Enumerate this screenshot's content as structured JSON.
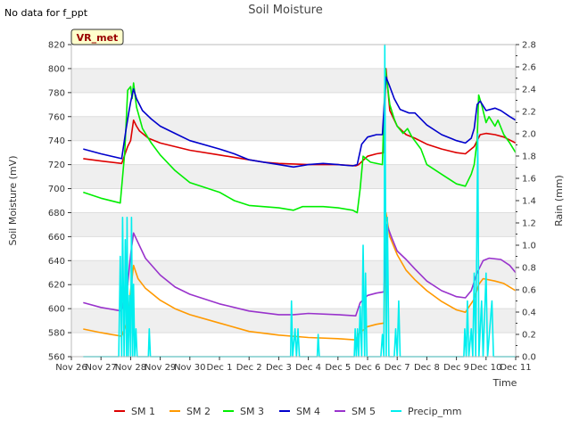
{
  "chart_data": {
    "type": "line",
    "title": "Soil Moisture",
    "top_note": "No data for f_ppt",
    "site_label": "VR_met",
    "xlabel": "Time",
    "ylabel": "Soil Moisture (mV)",
    "y2label": "Rain (mm)",
    "ylim": [
      560,
      820
    ],
    "y2lim": [
      0.0,
      2.8
    ],
    "xlim": [
      0,
      15
    ],
    "x_ticks": [
      "Nov 26",
      "Nov 27",
      "Nov 28",
      "Nov 29",
      "Nov 30",
      "Dec 1",
      "Dec 2",
      "Dec 3",
      "Dec 4",
      "Dec 5",
      "Dec 6",
      "Dec 7",
      "Dec 8",
      "Dec 9",
      "Dec 10",
      "Dec 11"
    ],
    "y_ticks": [
      560,
      580,
      600,
      620,
      640,
      660,
      680,
      700,
      720,
      740,
      760,
      780,
      800,
      820
    ],
    "y2_ticks": [
      "0.0",
      "0.2",
      "0.4",
      "0.6",
      "0.8",
      "1.0",
      "1.2",
      "1.4",
      "1.6",
      "1.8",
      "2.0",
      "2.2",
      "2.4",
      "2.6",
      "2.8"
    ],
    "grid": "horizontal bands",
    "legend_position": "bottom",
    "series": [
      {
        "name": "SM 1",
        "color": "#dd0000",
        "axis": "left",
        "points": [
          [
            0.4,
            725
          ],
          [
            1.0,
            723
          ],
          [
            1.7,
            721
          ],
          [
            1.9,
            735
          ],
          [
            2.0,
            740
          ],
          [
            2.1,
            757
          ],
          [
            2.2,
            752
          ],
          [
            2.3,
            748
          ],
          [
            2.6,
            742
          ],
          [
            3.0,
            738
          ],
          [
            4.0,
            732
          ],
          [
            5.0,
            728
          ],
          [
            6.0,
            724
          ],
          [
            6.5,
            722
          ],
          [
            7.0,
            721
          ],
          [
            8.0,
            720
          ],
          [
            9.0,
            720
          ],
          [
            9.6,
            719
          ],
          [
            9.7,
            720
          ],
          [
            10.0,
            727
          ],
          [
            10.3,
            729
          ],
          [
            10.55,
            730
          ],
          [
            10.62,
            800
          ],
          [
            10.75,
            765
          ],
          [
            11.0,
            752
          ],
          [
            11.3,
            745
          ],
          [
            11.6,
            742
          ],
          [
            12.0,
            737
          ],
          [
            12.5,
            733
          ],
          [
            13.0,
            730
          ],
          [
            13.3,
            729
          ],
          [
            13.6,
            735
          ],
          [
            13.8,
            745
          ],
          [
            14.0,
            746
          ],
          [
            14.3,
            745
          ],
          [
            14.6,
            743
          ],
          [
            15.0,
            738
          ]
        ]
      },
      {
        "name": "SM 2",
        "color": "#ff9900",
        "axis": "left",
        "points": [
          [
            0.4,
            583
          ],
          [
            1.0,
            580
          ],
          [
            1.7,
            577
          ],
          [
            1.9,
            590
          ],
          [
            2.0,
            615
          ],
          [
            2.1,
            636
          ],
          [
            2.25,
            625
          ],
          [
            2.5,
            617
          ],
          [
            3.0,
            607
          ],
          [
            3.5,
            600
          ],
          [
            4.0,
            595
          ],
          [
            5.0,
            588
          ],
          [
            6.0,
            581
          ],
          [
            7.0,
            578
          ],
          [
            8.0,
            576
          ],
          [
            9.0,
            575
          ],
          [
            9.6,
            574
          ],
          [
            9.7,
            579
          ],
          [
            10.0,
            585
          ],
          [
            10.3,
            587
          ],
          [
            10.55,
            588
          ],
          [
            10.62,
            680
          ],
          [
            10.75,
            660
          ],
          [
            11.0,
            645
          ],
          [
            11.3,
            632
          ],
          [
            11.6,
            624
          ],
          [
            12.0,
            615
          ],
          [
            12.5,
            606
          ],
          [
            13.0,
            599
          ],
          [
            13.3,
            597
          ],
          [
            13.6,
            608
          ],
          [
            13.75,
            620
          ],
          [
            13.9,
            625
          ],
          [
            14.3,
            623
          ],
          [
            14.6,
            621
          ],
          [
            15.0,
            615
          ]
        ]
      },
      {
        "name": "SM 3",
        "color": "#00ee00",
        "axis": "left",
        "points": [
          [
            0.4,
            697
          ],
          [
            1.0,
            692
          ],
          [
            1.65,
            688
          ],
          [
            1.8,
            730
          ],
          [
            1.9,
            782
          ],
          [
            2.0,
            785
          ],
          [
            2.05,
            775
          ],
          [
            2.1,
            788
          ],
          [
            2.2,
            768
          ],
          [
            2.4,
            750
          ],
          [
            2.7,
            738
          ],
          [
            3.0,
            728
          ],
          [
            3.5,
            715
          ],
          [
            4.0,
            705
          ],
          [
            5.0,
            697
          ],
          [
            5.5,
            690
          ],
          [
            6.0,
            686
          ],
          [
            7.0,
            684
          ],
          [
            7.5,
            682
          ],
          [
            7.8,
            685
          ],
          [
            8.5,
            685
          ],
          [
            9.0,
            684
          ],
          [
            9.5,
            682
          ],
          [
            9.65,
            680
          ],
          [
            9.75,
            700
          ],
          [
            9.85,
            727
          ],
          [
            10.1,
            722
          ],
          [
            10.5,
            720
          ],
          [
            10.6,
            800
          ],
          [
            10.75,
            770
          ],
          [
            10.9,
            758
          ],
          [
            11.0,
            752
          ],
          [
            11.2,
            746
          ],
          [
            11.35,
            750
          ],
          [
            11.5,
            743
          ],
          [
            11.8,
            733
          ],
          [
            12.0,
            720
          ],
          [
            12.5,
            712
          ],
          [
            13.0,
            704
          ],
          [
            13.3,
            702
          ],
          [
            13.5,
            712
          ],
          [
            13.6,
            720
          ],
          [
            13.7,
            740
          ],
          [
            13.75,
            778
          ],
          [
            13.85,
            770
          ],
          [
            14.0,
            755
          ],
          [
            14.1,
            760
          ],
          [
            14.3,
            752
          ],
          [
            14.4,
            757
          ],
          [
            14.6,
            745
          ],
          [
            14.8,
            738
          ],
          [
            15.0,
            730
          ]
        ]
      },
      {
        "name": "SM 4",
        "color": "#0000cc",
        "axis": "left",
        "points": [
          [
            0.4,
            733
          ],
          [
            1.0,
            729
          ],
          [
            1.7,
            725
          ],
          [
            1.85,
            750
          ],
          [
            1.95,
            765
          ],
          [
            2.0,
            772
          ],
          [
            2.1,
            783
          ],
          [
            2.2,
            775
          ],
          [
            2.4,
            765
          ],
          [
            2.7,
            758
          ],
          [
            3.0,
            752
          ],
          [
            3.5,
            746
          ],
          [
            4.0,
            740
          ],
          [
            5.0,
            733
          ],
          [
            5.5,
            729
          ],
          [
            6.0,
            724
          ],
          [
            6.5,
            722
          ],
          [
            7.0,
            720
          ],
          [
            7.5,
            718
          ],
          [
            8.0,
            720
          ],
          [
            8.5,
            721
          ],
          [
            9.0,
            720
          ],
          [
            9.5,
            719
          ],
          [
            9.65,
            720
          ],
          [
            9.8,
            737
          ],
          [
            10.0,
            743
          ],
          [
            10.3,
            745
          ],
          [
            10.5,
            745
          ],
          [
            10.62,
            793
          ],
          [
            10.75,
            785
          ],
          [
            10.9,
            775
          ],
          [
            11.1,
            766
          ],
          [
            11.4,
            763
          ],
          [
            11.6,
            763
          ],
          [
            12.0,
            753
          ],
          [
            12.5,
            745
          ],
          [
            13.0,
            740
          ],
          [
            13.3,
            738
          ],
          [
            13.5,
            742
          ],
          [
            13.6,
            750
          ],
          [
            13.7,
            770
          ],
          [
            13.8,
            773
          ],
          [
            14.0,
            765
          ],
          [
            14.3,
            767
          ],
          [
            14.5,
            765
          ],
          [
            14.8,
            760
          ],
          [
            15.0,
            757
          ]
        ]
      },
      {
        "name": "SM 5",
        "color": "#9933cc",
        "axis": "left",
        "points": [
          [
            0.4,
            605
          ],
          [
            1.0,
            601
          ],
          [
            1.7,
            598
          ],
          [
            1.9,
            620
          ],
          [
            2.0,
            645
          ],
          [
            2.1,
            663
          ],
          [
            2.25,
            655
          ],
          [
            2.5,
            642
          ],
          [
            3.0,
            628
          ],
          [
            3.5,
            618
          ],
          [
            4.0,
            612
          ],
          [
            5.0,
            604
          ],
          [
            6.0,
            598
          ],
          [
            7.0,
            595
          ],
          [
            7.5,
            595
          ],
          [
            8.0,
            596
          ],
          [
            9.0,
            595
          ],
          [
            9.6,
            594
          ],
          [
            9.75,
            605
          ],
          [
            10.0,
            611
          ],
          [
            10.3,
            613
          ],
          [
            10.55,
            614
          ],
          [
            10.65,
            670
          ],
          [
            10.8,
            660
          ],
          [
            11.0,
            648
          ],
          [
            11.3,
            641
          ],
          [
            11.6,
            633
          ],
          [
            12.0,
            623
          ],
          [
            12.5,
            615
          ],
          [
            13.0,
            610
          ],
          [
            13.3,
            609
          ],
          [
            13.5,
            615
          ],
          [
            13.7,
            630
          ],
          [
            13.9,
            640
          ],
          [
            14.1,
            642
          ],
          [
            14.5,
            641
          ],
          [
            14.8,
            636
          ],
          [
            15.0,
            630
          ]
        ]
      },
      {
        "name": "Precip_mm",
        "color": "#00eeee",
        "axis": "right",
        "points": [
          [
            0.4,
            0
          ],
          [
            1.6,
            0
          ],
          [
            1.65,
            0.9
          ],
          [
            1.7,
            0
          ],
          [
            1.73,
            1.25
          ],
          [
            1.78,
            0
          ],
          [
            1.82,
            1.05
          ],
          [
            1.86,
            0
          ],
          [
            1.88,
            1.25
          ],
          [
            1.92,
            0
          ],
          [
            1.96,
            0.55
          ],
          [
            2.0,
            0
          ],
          [
            2.03,
            1.25
          ],
          [
            2.07,
            0
          ],
          [
            2.1,
            0.65
          ],
          [
            2.14,
            0
          ],
          [
            2.18,
            0.25
          ],
          [
            2.22,
            0
          ],
          [
            2.6,
            0
          ],
          [
            2.63,
            0.25
          ],
          [
            2.67,
            0
          ],
          [
            7.4,
            0
          ],
          [
            7.43,
            0.5
          ],
          [
            7.47,
            0
          ],
          [
            7.55,
            0.25
          ],
          [
            7.6,
            0
          ],
          [
            7.65,
            0.25
          ],
          [
            7.7,
            0
          ],
          [
            8.3,
            0
          ],
          [
            8.33,
            0.2
          ],
          [
            8.37,
            0
          ],
          [
            9.55,
            0
          ],
          [
            9.58,
            0.25
          ],
          [
            9.62,
            0
          ],
          [
            9.66,
            0.25
          ],
          [
            9.7,
            0
          ],
          [
            9.75,
            0.45
          ],
          [
            9.8,
            0
          ],
          [
            9.85,
            1.0
          ],
          [
            9.9,
            0
          ],
          [
            9.93,
            0.75
          ],
          [
            9.98,
            0
          ],
          [
            10.45,
            0
          ],
          [
            10.5,
            0.2
          ],
          [
            10.55,
            0
          ],
          [
            10.58,
            2.8
          ],
          [
            10.63,
            0
          ],
          [
            10.67,
            1.25
          ],
          [
            10.72,
            0
          ],
          [
            10.9,
            0
          ],
          [
            10.95,
            0.25
          ],
          [
            11.0,
            0
          ],
          [
            11.05,
            0.5
          ],
          [
            11.1,
            0
          ],
          [
            13.25,
            0
          ],
          [
            13.28,
            0.25
          ],
          [
            13.33,
            0
          ],
          [
            13.37,
            0.5
          ],
          [
            13.42,
            0
          ],
          [
            13.5,
            0.25
          ],
          [
            13.55,
            0
          ],
          [
            13.6,
            0.75
          ],
          [
            13.65,
            0
          ],
          [
            13.72,
            2.0
          ],
          [
            13.76,
            0
          ],
          [
            13.85,
            0.5
          ],
          [
            13.9,
            0
          ],
          [
            14.0,
            0.75
          ],
          [
            14.05,
            0
          ],
          [
            14.2,
            0.5
          ],
          [
            14.25,
            0
          ],
          [
            15.0,
            0
          ]
        ]
      }
    ]
  }
}
